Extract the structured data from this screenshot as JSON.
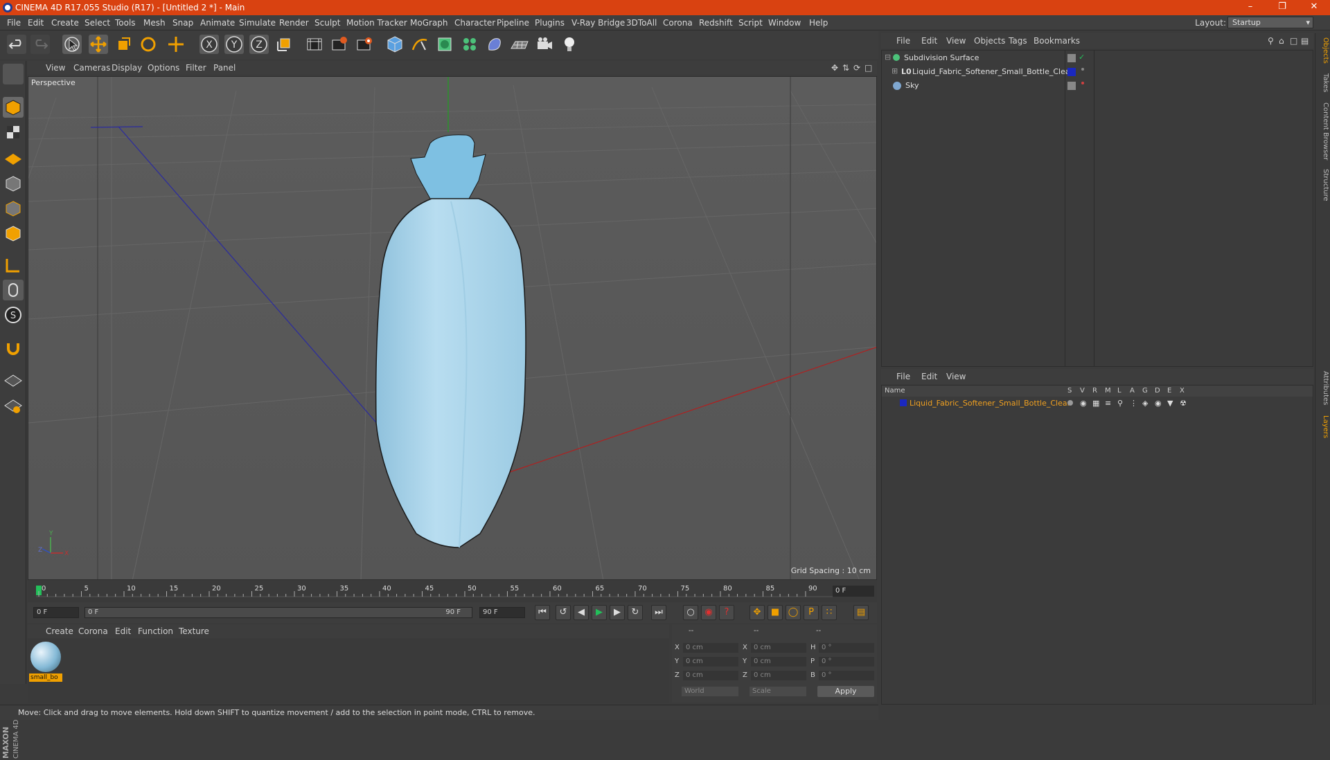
{
  "window": {
    "title": "CINEMA 4D R17.055 Studio (R17) - [Untitled 2 *] - Main"
  },
  "menubar": {
    "items": [
      "File",
      "Edit",
      "Create",
      "Select",
      "Tools",
      "Mesh",
      "Snap",
      "Animate",
      "Simulate",
      "Render",
      "Sculpt",
      "Motion Tracker",
      "MoGraph",
      "Character",
      "Pipeline",
      "Plugins",
      "V-Ray Bridge",
      "3DToAll",
      "Corona",
      "Redshift",
      "Script",
      "Window",
      "Help"
    ],
    "layout_label": "Layout:",
    "layout_value": "Startup"
  },
  "viewport": {
    "menu": [
      "View",
      "Cameras",
      "Display",
      "Options",
      "Filter",
      "Panel"
    ],
    "label": "Perspective",
    "grid_spacing": "Grid Spacing : 10 cm"
  },
  "timeline": {
    "ticks": [
      "0",
      "5",
      "10",
      "15",
      "20",
      "25",
      "30",
      "35",
      "40",
      "45",
      "50",
      "55",
      "60",
      "65",
      "70",
      "75",
      "80",
      "85",
      "90"
    ],
    "current_frame": "0 F"
  },
  "transport": {
    "start_frame": "0 F",
    "range_start": "0 F",
    "range_end": "90 F",
    "end_frame": "90 F"
  },
  "material_manager": {
    "menu": [
      "Create",
      "Corona",
      "Edit",
      "Function",
      "Texture"
    ],
    "material_name": "small_bo"
  },
  "coordinates": {
    "header": [
      "--",
      "--",
      "--"
    ],
    "rows": [
      {
        "axis": "X",
        "pos": "0 cm",
        "size_axis": "X",
        "size": "0 cm",
        "rot_axis": "H",
        "rot": "0 °"
      },
      {
        "axis": "Y",
        "pos": "0 cm",
        "size_axis": "Y",
        "size": "0 cm",
        "rot_axis": "P",
        "rot": "0 °"
      },
      {
        "axis": "Z",
        "pos": "0 cm",
        "size_axis": "Z",
        "size": "0 cm",
        "rot_axis": "B",
        "rot": "0 °"
      }
    ],
    "mode_world": "World",
    "mode_scale": "Scale",
    "apply": "Apply"
  },
  "status": {
    "text": "Move: Click and drag to move elements. Hold down SHIFT to quantize movement / add to the selection in point mode, CTRL to remove."
  },
  "object_manager": {
    "menu": [
      "File",
      "Edit",
      "View",
      "Objects",
      "Tags",
      "Bookmarks"
    ],
    "objects": [
      {
        "name": "Subdivision Surface"
      },
      {
        "name": "Liquid_Fabric_Softener_Small_Bottle_Clear"
      },
      {
        "name": "Sky"
      }
    ]
  },
  "layer_manager": {
    "menu": [
      "File",
      "Edit",
      "View"
    ],
    "columns": [
      "Name",
      "S",
      "V",
      "R",
      "M",
      "L",
      "A",
      "G",
      "D",
      "E",
      "X"
    ],
    "layer_name": "Liquid_Fabric_Softener_Small_Bottle_Clear"
  },
  "right_tabs": [
    "Objects",
    "Takes",
    "Content Browser",
    "Structure",
    "Attributes",
    "Layers"
  ],
  "brand": {
    "maxon": "MAXON",
    "product": "CINEMA 4D"
  },
  "colors": {
    "titlebar": "#d94211",
    "accent_orange": "#f0a000",
    "bottle": "#a9d4ea"
  }
}
